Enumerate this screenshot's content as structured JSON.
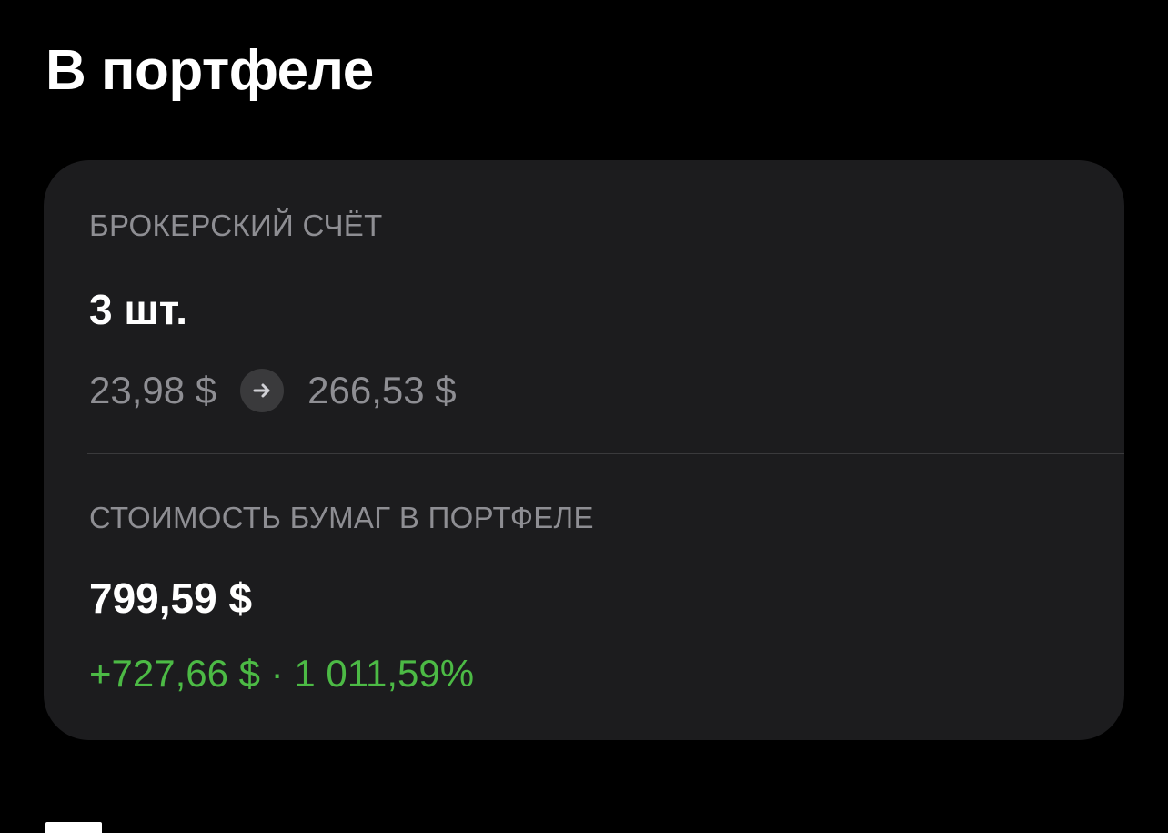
{
  "page": {
    "title": "В портфеле"
  },
  "brokerage": {
    "label": "БРОКЕРСКИЙ СЧЁТ",
    "quantity": "3 шт.",
    "avg_price": "23,98 $",
    "arrow_icon": "arrow-right-icon",
    "current_price": "266,53 $"
  },
  "securities": {
    "label": "СТОИМОСТЬ БУМАГ В ПОРТФЕЛЕ",
    "value": "799,59 $",
    "gain_amount": "+727,66 $",
    "gain_separator": " · ",
    "gain_percent": "1 011,59%"
  },
  "colors": {
    "background": "#000000",
    "card": "#1c1c1e",
    "secondary_text": "#8e8e93",
    "positive": "#4cba45"
  }
}
